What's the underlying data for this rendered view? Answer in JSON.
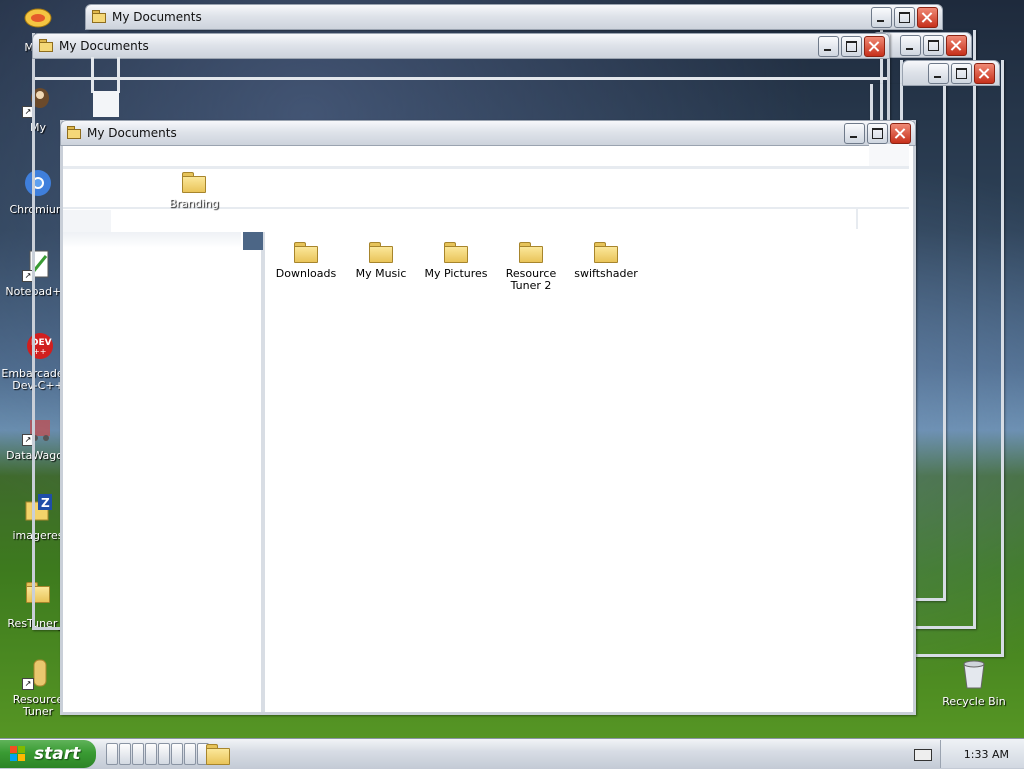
{
  "desktop": {
    "icons": [
      {
        "label": "My C",
        "icon": "computer-icon"
      },
      {
        "label": "My",
        "icon": "dog-icon"
      },
      {
        "label": "Chromium",
        "icon": "chromium-icon"
      },
      {
        "label": "Notepad++",
        "icon": "notepad-icon"
      },
      {
        "label": "Embarcadero Dev-C++",
        "icon": "devcpp-icon"
      },
      {
        "label": "DataWagon",
        "icon": "datawagon-icon"
      },
      {
        "label": "imageres",
        "icon": "imageres-icon"
      },
      {
        "label": "ResTuner_s",
        "icon": "folder-icon"
      },
      {
        "label": "Resource Tuner",
        "icon": "resource-tuner-icon"
      }
    ],
    "recycle_bin": "Recycle Bin"
  },
  "windows": {
    "back1_title": "My Documents",
    "back2_title": "My Documents",
    "front_title": "My Documents"
  },
  "front_window": {
    "branding_label": "Branding",
    "files": [
      {
        "label": "Downloads"
      },
      {
        "label": "My Music"
      },
      {
        "label": "My Pictures"
      },
      {
        "label": "Resource Tuner 2"
      },
      {
        "label": "swiftshader"
      }
    ]
  },
  "taskbar": {
    "start_label": "start",
    "clock": "1:33 AM",
    "colors": {
      "start": "#3a9b33",
      "close_button": "#c6301b"
    }
  }
}
